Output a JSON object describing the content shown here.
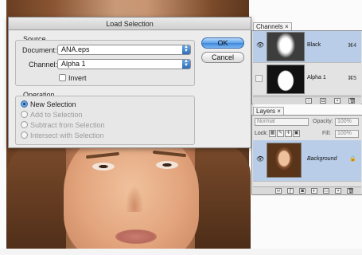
{
  "dialog": {
    "title": "Load Selection",
    "source_label": "Source",
    "document_label": "Document:",
    "document_value": "ANA.eps",
    "channel_label": "Channel:",
    "channel_value": "Alpha 1",
    "invert_label": "Invert",
    "invert_checked": false,
    "operation_label": "Operation",
    "operations": [
      {
        "label": "New Selection",
        "selected": true,
        "enabled": true
      },
      {
        "label": "Add to Selection",
        "selected": false,
        "enabled": false
      },
      {
        "label": "Subtract from Selection",
        "selected": false,
        "enabled": false
      },
      {
        "label": "Intersect with Selection",
        "selected": false,
        "enabled": false
      }
    ],
    "ok_label": "OK",
    "cancel_label": "Cancel"
  },
  "channels_panel": {
    "tab_label": "Channels",
    "tab_close": "×",
    "channels": [
      {
        "name": "Black",
        "shortcut": "⌘4",
        "selected": true,
        "visible": true
      },
      {
        "name": "Alpha 1",
        "shortcut": "⌘5",
        "selected": false,
        "visible": false
      }
    ]
  },
  "layers_panel": {
    "tab_label": "Layers",
    "tab_close": "×",
    "blend_mode": "Normal",
    "opacity_label": "Opacity:",
    "opacity_value": "100%",
    "lock_label": "Lock:",
    "fill_label": "Fill:",
    "fill_value": "100%",
    "layers": [
      {
        "name": "Background",
        "selected": true,
        "visible": true
      }
    ]
  }
}
